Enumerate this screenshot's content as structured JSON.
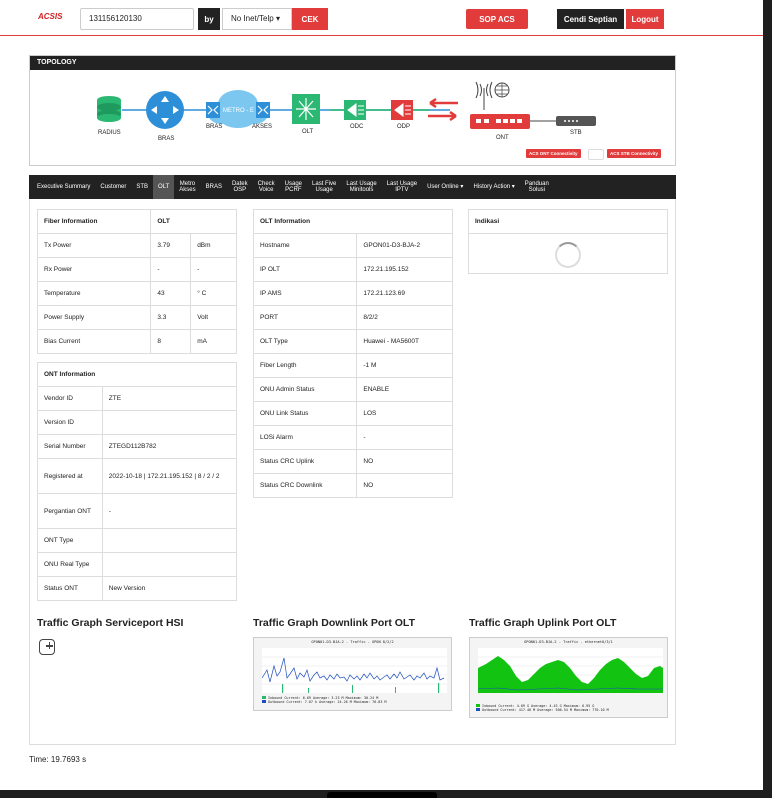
{
  "header": {
    "logo": "ACSIS",
    "search_value": "131156120130",
    "by_label": "by",
    "select_value": "No Inet/Telp",
    "cek_label": "CEK",
    "sop_label": "SOP ACS",
    "user_name": "Cendi Septian",
    "logout_label": "Logout"
  },
  "topology": {
    "title": "TOPOLOGY",
    "nodes": {
      "radius": "RADIUS",
      "bras1": "BRAS",
      "bras2": "BRAS",
      "metro": "METRO - E",
      "akses": "AKSES",
      "olt": "OLT",
      "odc": "ODC",
      "odp": "ODP",
      "ont": "ONT",
      "stb": "STB"
    },
    "ont_btn": "ACS ONT Connectivity",
    "stb_btn": "ACS STB Connectivity",
    "colors": {
      "green": "#2bb873",
      "blue": "#2d8fd8",
      "red": "#e23b3b"
    }
  },
  "nav": [
    "Executive Summary",
    "Customer",
    "STB",
    "OLT",
    "Metro|Akses",
    "BRAS",
    "Datek|OSP",
    "Check|Voice",
    "Usage|PCRF",
    "Last Five|Usage",
    "Last Usage|Minitools",
    "Last Usage|IPTV",
    "User Online ▾",
    "History Action ▾",
    "Panduan|Solusi"
  ],
  "fiber": {
    "h1": "Fiber Information",
    "h2": "OLT",
    "rows": [
      [
        "Tx Power",
        "3.79",
        "dBm"
      ],
      [
        "Rx Power",
        "-",
        "-"
      ],
      [
        "Temperature",
        "43",
        "° C"
      ],
      [
        "Power Supply",
        "3.3",
        "Volt"
      ],
      [
        "Bias Current",
        "8",
        "mA"
      ]
    ]
  },
  "ont": {
    "h": "ONT Information",
    "rows": [
      [
        "Vendor ID",
        "ZTE"
      ],
      [
        "Version ID",
        ""
      ],
      [
        "Serial Number",
        "ZTEGD112B782"
      ],
      [
        "Registered at",
        "2022-10-18 | 172.21.195.152 | 8 / 2 / 2"
      ],
      [
        "Pergantian ONT",
        "-"
      ],
      [
        "ONT Type",
        ""
      ],
      [
        "ONU Real Type",
        ""
      ],
      [
        "Status ONT",
        "New Version"
      ]
    ]
  },
  "olt": {
    "h": "OLT Information",
    "rows": [
      [
        "Hostname",
        "GPON01-D3-BJA-2"
      ],
      [
        "IP OLT",
        "172.21.195.152"
      ],
      [
        "IP AMS",
        "172.21.123.69"
      ],
      [
        "PORT",
        "8/2/2"
      ],
      [
        "OLT Type",
        "Huawei - MA5600T"
      ],
      [
        "Fiber Length",
        "-1 M"
      ],
      [
        "ONU Admin Status",
        "ENABLE"
      ],
      [
        "ONU Link Status",
        "LOS"
      ],
      [
        "LOSi Alarm",
        "-"
      ],
      [
        "Status CRC Uplink",
        "NO"
      ],
      [
        "Status CRC Downlink",
        "NO"
      ]
    ]
  },
  "indikasi": {
    "h": "Indikasi"
  },
  "graphs": {
    "g1": "Traffic Graph Serviceport HSI",
    "g2": "Traffic Graph Downlink Port OLT",
    "g3": "Traffic Graph Uplink Port OLT",
    "g2_caption": "GPON01-D3-BJA-2 - Traffic - GPON 8/2/2",
    "g3_caption": "GPON01-D3-BJA-2 - Traffic - ethernet0/3/1",
    "g2_legend": [
      "Inbound  Current:  6.69  Average:  3.23 M  Maximum:  30.24 M",
      "Outbound Current:  7.07 k  Average: 24.26 M  Maximum:  76.83 M"
    ],
    "g3_legend": [
      "Inbound  Current:  4.69 G  Average:  4.43 G  Maximum:  6.95 G",
      "Outbound Current: 417.40 M  Average: 506.54 M  Maximum: 770.10 M"
    ]
  },
  "footer": {
    "time": "Time: 19.7693 s"
  }
}
